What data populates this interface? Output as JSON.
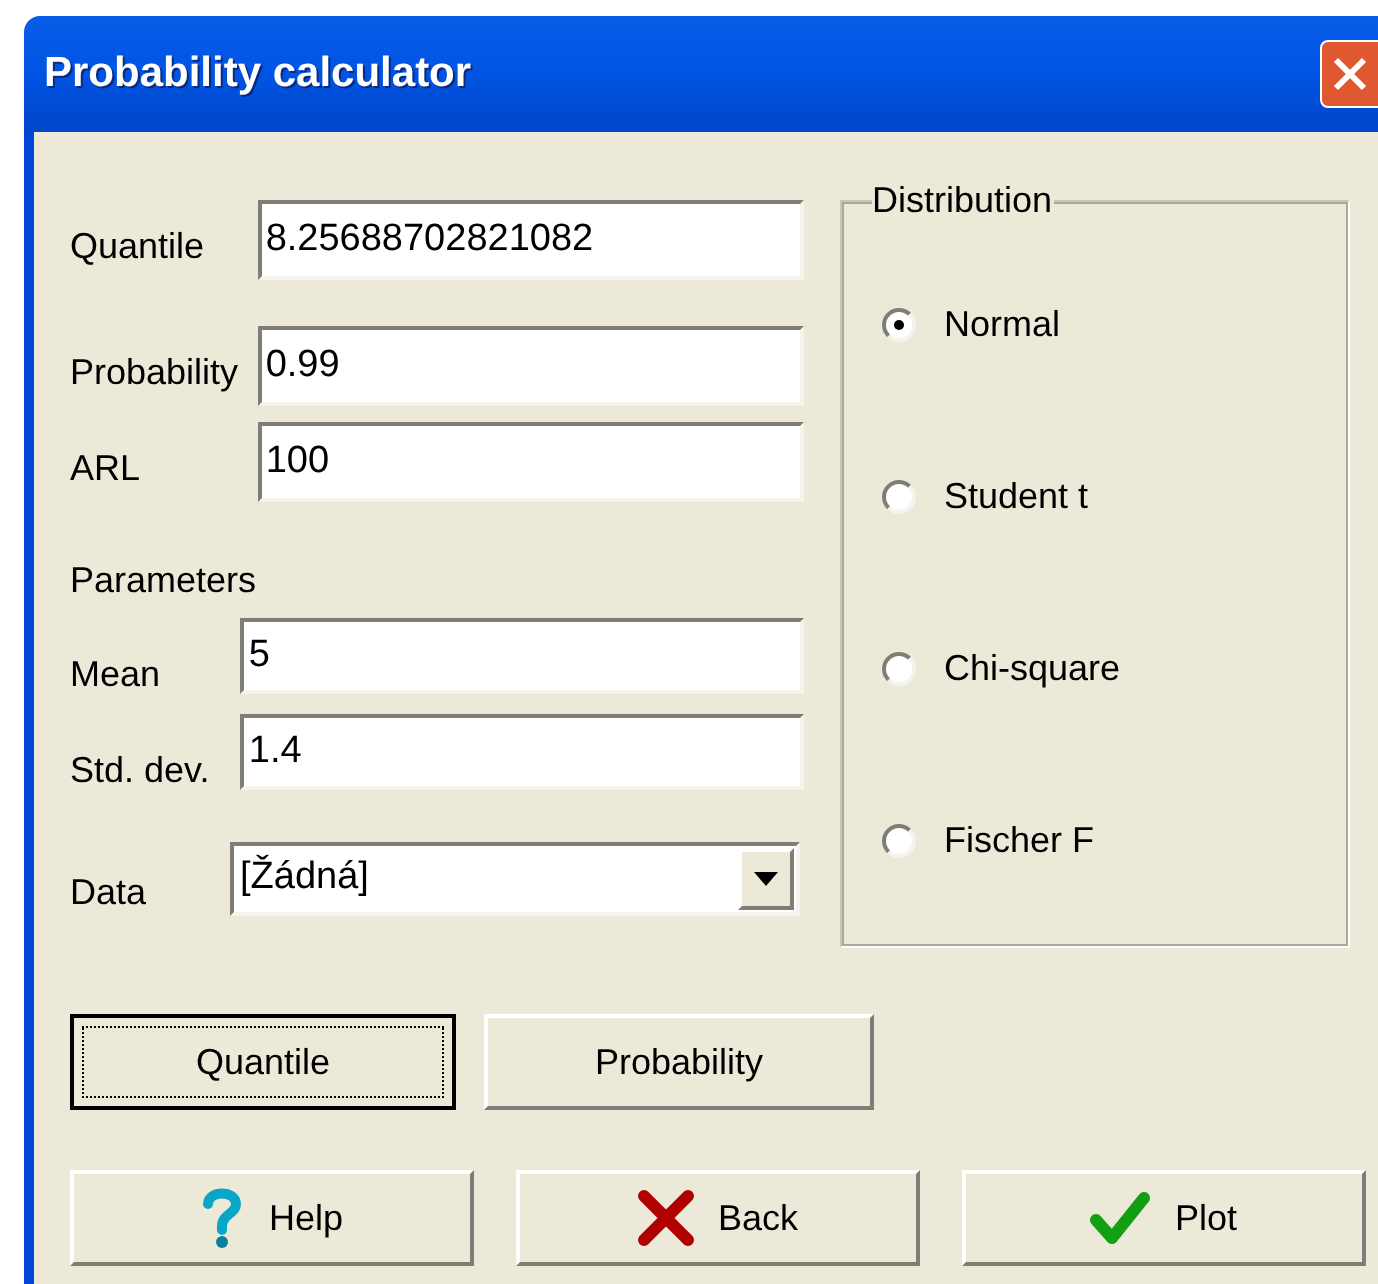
{
  "window": {
    "title": "Probability calculator"
  },
  "fields": [
    {
      "label": "Quantile",
      "value": "8.25688702821082"
    },
    {
      "label": "Probability",
      "value": "0.99"
    },
    {
      "label": "ARL",
      "value": "100"
    }
  ],
  "parameters": {
    "title": "Parameters",
    "fields": [
      {
        "label": "Mean",
        "value": "5"
      },
      {
        "label": "Std. dev.",
        "value": "1.4"
      }
    ]
  },
  "data": {
    "label": "Data",
    "value": "[Žádná]"
  },
  "distribution": {
    "title": "Distribution",
    "options": [
      {
        "label": "Normal",
        "selected": true
      },
      {
        "label": "Student t",
        "selected": false
      },
      {
        "label": "Chi-square",
        "selected": false
      },
      {
        "label": "Fischer F",
        "selected": false
      }
    ]
  },
  "action_buttons": [
    {
      "label": "Quantile",
      "default": true
    },
    {
      "label": "Probability",
      "default": false
    }
  ],
  "footer_buttons": [
    {
      "label": "Help",
      "kind": "help"
    },
    {
      "label": "Back",
      "kind": "back"
    },
    {
      "label": "Plot",
      "kind": "plot"
    }
  ]
}
